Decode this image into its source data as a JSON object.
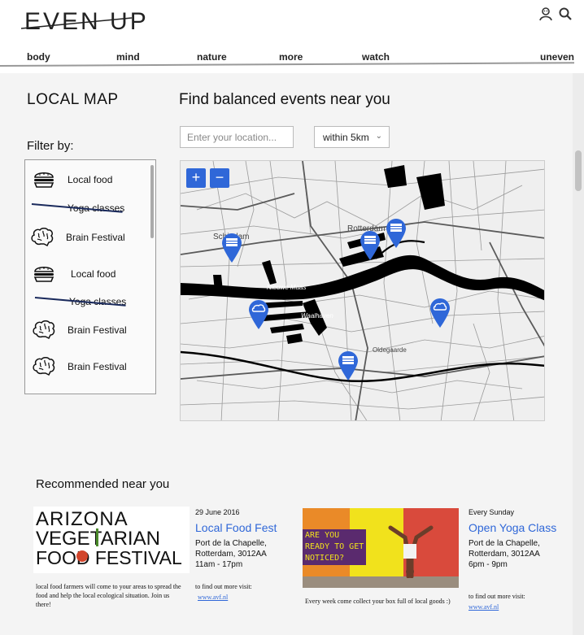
{
  "header": {
    "logo": "EVEN UP",
    "nav": [
      "body",
      "mind",
      "nature",
      "more",
      "watch"
    ],
    "right_link": "uneven"
  },
  "icons": [
    "user-icon",
    "search-icon",
    "burger-icon",
    "brain-icon",
    "map-pin-icon"
  ],
  "colors": {
    "accent": "#2f67d8",
    "strike": "#1a2a5c"
  },
  "local_map": {
    "title": "LOCAL MAP",
    "heading": "Find balanced events near you",
    "location_placeholder": "Enter your location...",
    "radius": "within 5km",
    "filter_title": "Filter by:",
    "filters": [
      {
        "label": "Local food",
        "icon": "burger-icon",
        "struck": false
      },
      {
        "label": "Yoga classes",
        "icon": "",
        "struck": true
      },
      {
        "label": "Brain Festival",
        "icon": "brain-icon",
        "struck": false
      },
      {
        "label": "Local food",
        "icon": "burger-icon",
        "struck": false
      },
      {
        "label": "Yoga classes",
        "icon": "",
        "struck": true
      },
      {
        "label": "Brain Festival",
        "icon": "brain-icon",
        "struck": false
      },
      {
        "label": "Brain Festival",
        "icon": "brain-icon",
        "struck": false
      }
    ],
    "map": {
      "zoom_in": "+",
      "zoom_out": "−",
      "labels": [
        "Schiedam",
        "Rotterdam",
        "Nieuwe Maas",
        "Waalhaven",
        "Oldegaarde"
      ]
    }
  },
  "recommended": {
    "title": "Recommended near you",
    "cards": [
      {
        "image_text": [
          "ARIZONA",
          "VEGETARIAN",
          "FOOD FESTIVAL"
        ],
        "date": "29 June 2016",
        "title": "Local Food Fest",
        "address": [
          "Port de la Chapelle,",
          "Rotterdam, 3012AA",
          "11am - 17pm"
        ],
        "description": "local food farmers will come to your areas to spread the food and help the local ecological situation. Join us there!",
        "more_text": "to find out more visit:",
        "link": "www.avf.nl"
      },
      {
        "image_text": [
          "ARE YOU",
          "READY TO GET",
          "NOTICED?"
        ],
        "date": "Every Sunday",
        "title": "Open Yoga Class",
        "address": [
          "Port de la Chapelle,",
          "Rotterdam, 3012AA",
          "6pm - 9pm"
        ],
        "description": "Every week come collect your box full of local goods :)",
        "more_text": "to find out more visit:",
        "link": "www.avf.nl"
      }
    ]
  }
}
